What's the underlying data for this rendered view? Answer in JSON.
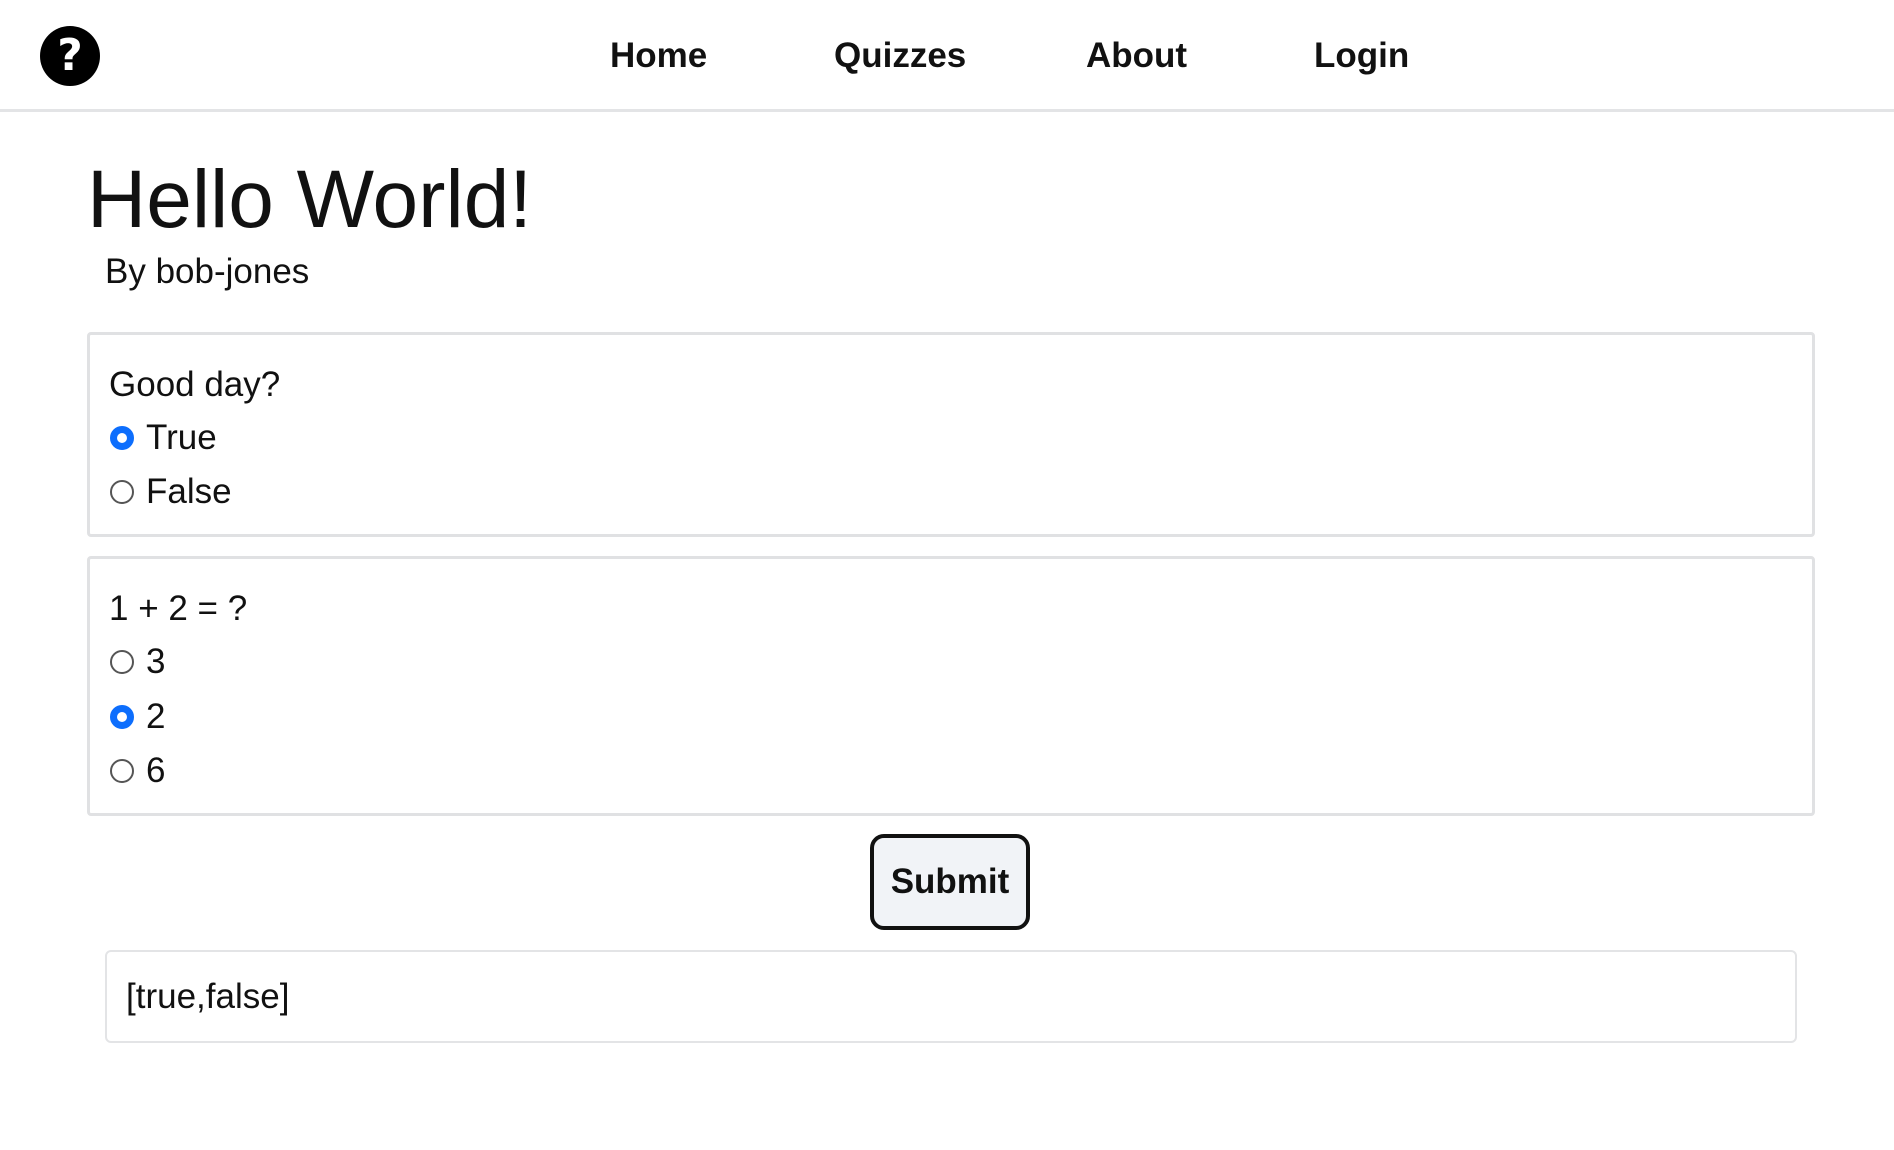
{
  "nav": {
    "logo_glyph": "?",
    "links": [
      "Home",
      "Quizzes",
      "About",
      "Login"
    ]
  },
  "quiz": {
    "title": "Hello World!",
    "author": "By bob-jones",
    "questions": [
      {
        "text": "Good day?",
        "options": [
          "True",
          "False"
        ],
        "selected": "True"
      },
      {
        "text": "1 + 2 = ?",
        "options": [
          "3",
          "2",
          "6"
        ],
        "selected": "2"
      }
    ],
    "submit_label": "Submit",
    "result": "[true,false]"
  },
  "colors": {
    "accent": "#0d6efd",
    "border": "#e0e1e3",
    "button_bg": "#f1f3f7"
  },
  "icons": {
    "logo": "question-mark-circle-icon"
  }
}
